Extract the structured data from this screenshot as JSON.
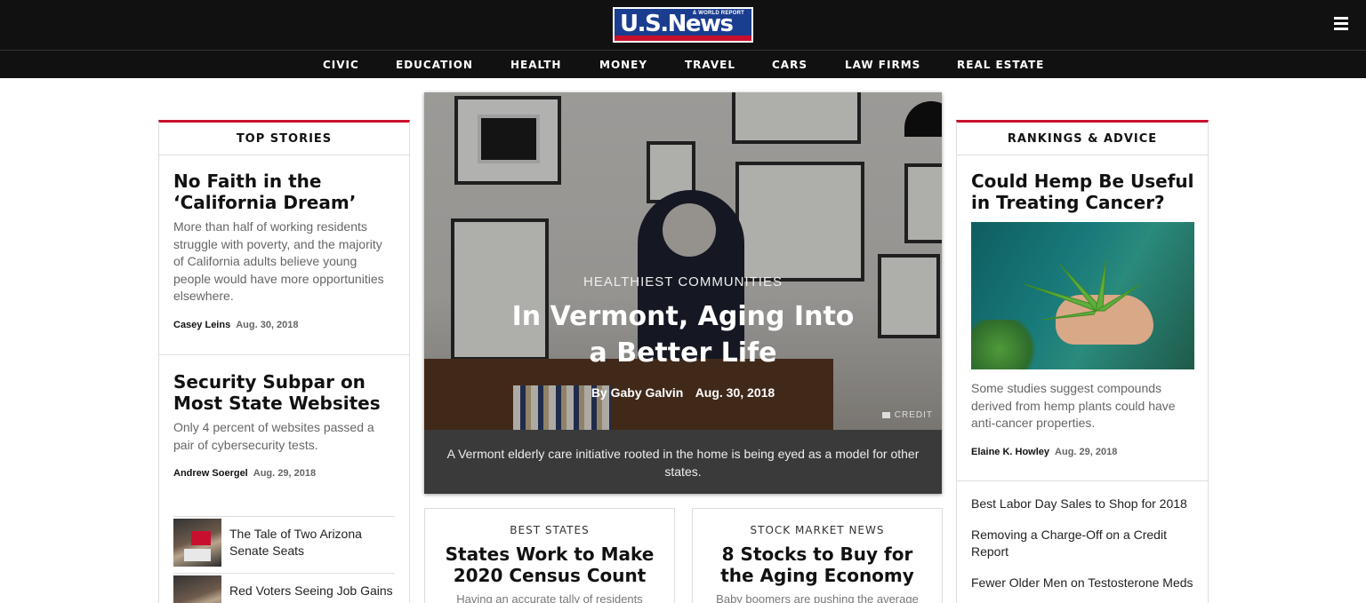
{
  "header": {
    "logo_text": "U.S.News",
    "logo_sub": "& WORLD REPORT",
    "menu_icon": "hamburger-icon"
  },
  "nav": {
    "items": [
      "CIVIC",
      "EDUCATION",
      "HEALTH",
      "MONEY",
      "TRAVEL",
      "CARS",
      "LAW FIRMS",
      "REAL ESTATE"
    ]
  },
  "top_stories": {
    "header": "TOP STORIES",
    "stories": [
      {
        "title": "No Faith in the ‘California Dream’",
        "desc": "More than half of working residents struggle with poverty, and the majority of California adults believe young people would have more opportunities elsewhere.",
        "author": "Casey Leins",
        "date": "Aug. 30, 2018"
      },
      {
        "title": "Security Subpar on Most State Websites",
        "desc": "Only 4 percent of websites passed a pair of cybersecurity tests.",
        "author": "Andrew Soergel",
        "date": "Aug. 29, 2018"
      }
    ],
    "mini": [
      {
        "title": "The Tale of Two Arizona Senate Seats"
      },
      {
        "title": "Red Voters Seeing Job Gains Under Trump"
      }
    ]
  },
  "hero": {
    "kicker": "HEALTHIEST COMMUNITIES",
    "title": "In Vermont, Aging Into a Better Life",
    "by": "By",
    "author": "Gaby Galvin",
    "date": "Aug. 30, 2018",
    "credit": "CREDIT",
    "caption": "A Vermont elderly care initiative rooted in the home is being eyed as a model for other states."
  },
  "bottom_cards": [
    {
      "kicker": "BEST STATES",
      "title": "States Work to Make 2020 Census Count",
      "desc": "Having an accurate tally of residents"
    },
    {
      "kicker": "STOCK MARKET NEWS",
      "title": "8 Stocks to Buy for the Aging Economy",
      "desc": "Baby boomers are pushing the average"
    }
  ],
  "rankings": {
    "header": "RANKINGS & ADVICE",
    "feature": {
      "title": "Could Hemp Be Useful in Treating Cancer?",
      "desc": "Some studies suggest compounds derived from hemp plants could have anti-cancer properties.",
      "author": "Elaine K. Howley",
      "date": "Aug. 29, 2018"
    },
    "links": [
      "Best Labor Day Sales to Shop for 2018",
      "Removing a Charge-Off on a Credit Report",
      "Fewer Older Men on Testosterone Meds"
    ]
  },
  "colors": {
    "header_bg": "#111111",
    "accent_red": "#c8102e",
    "logo_blue": "#1a3d8f"
  }
}
